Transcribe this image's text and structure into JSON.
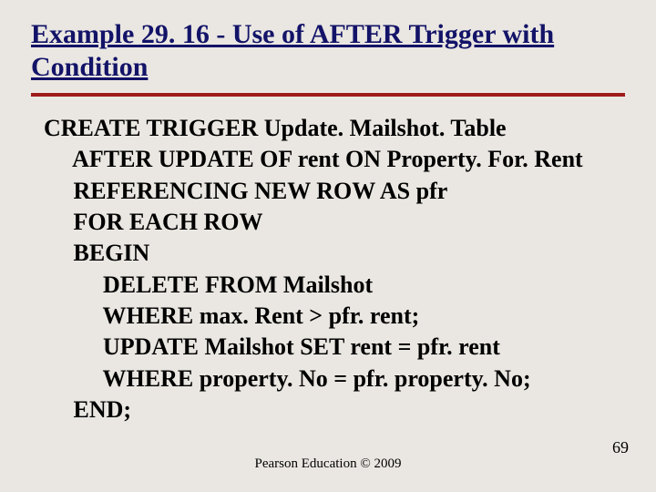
{
  "title": {
    "line1_pre": "Example 29. 16 - Use of AFTER Trigger with",
    "line2": "Condition"
  },
  "code": {
    "l1": "CREATE TRIGGER Update. Mailshot. Table",
    "l2": "AFTER UPDATE OF rent ON Property. For. Rent",
    "l3": "REFERENCING NEW ROW AS pfr",
    "l4": "FOR EACH ROW",
    "l5": "BEGIN",
    "l6": "DELETE FROM Mailshot",
    "l7": "WHERE max. Rent > pfr. rent;",
    "l8": "UPDATE Mailshot SET rent = pfr. rent",
    "l9": "WHERE property. No = pfr. property. No;",
    "l10": "END;"
  },
  "footer": "Pearson Education © 2009",
  "pagenum": "69"
}
